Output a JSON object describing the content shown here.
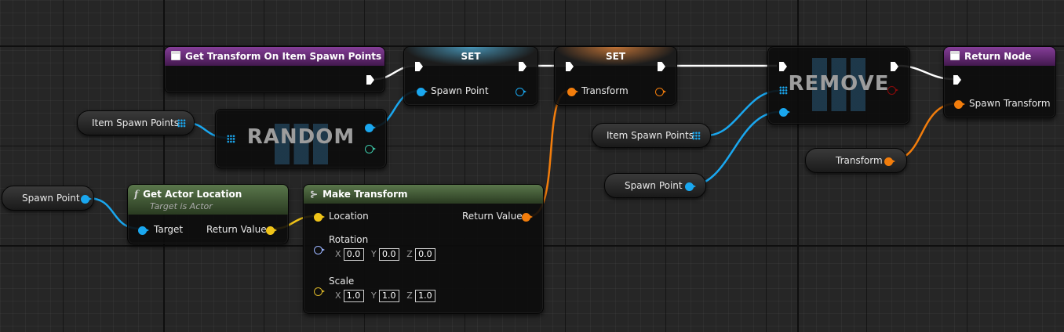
{
  "nodes": {
    "get_transform": {
      "title": "Get Transform On Item Spawn Points"
    },
    "random": {
      "title": "RANDOM"
    },
    "set1": {
      "title": "SET",
      "pin": "Spawn Point"
    },
    "set2": {
      "title": "SET",
      "pin": "Transform"
    },
    "remove": {
      "title": "REMOVE"
    },
    "return_node": {
      "title": "Return Node",
      "pin": "Spawn Transform"
    },
    "get_actor_location": {
      "title": "Get Actor Location",
      "subtitle": "Target is Actor",
      "input": "Target",
      "output": "Return Value"
    },
    "make_transform": {
      "title": "Make Transform",
      "location": "Location",
      "rotation": "Rotation",
      "scale": "Scale",
      "return": "Return Value",
      "rot": {
        "x": "0.0",
        "y": "0.0",
        "z": "0.0"
      },
      "scl": {
        "x": "1.0",
        "y": "1.0",
        "z": "1.0"
      },
      "axes": {
        "x": "X",
        "y": "Y",
        "z": "Z"
      }
    }
  },
  "variables": {
    "item_spawn_points_1": "Item Spawn Points",
    "item_spawn_points_2": "Item Spawn Points",
    "spawn_point_1": "Spawn Point",
    "spawn_point_2": "Spawn Point",
    "transform": "Transform"
  },
  "colors": {
    "object_pin": "#1aa7ef",
    "transform_pin": "#f27d0c",
    "vector_pin": "#f0c419",
    "function_header": "#4c6b3c",
    "event_header": "#7a2d8f"
  },
  "icons": [
    "document-icon",
    "function-icon",
    "struct-icon",
    "array-icon"
  ]
}
